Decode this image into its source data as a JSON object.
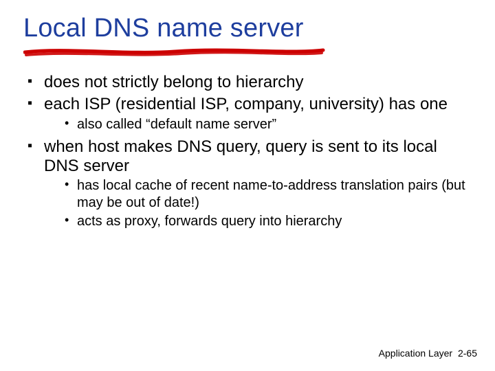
{
  "title": "Local DNS name server",
  "underline_color": "#cc0000",
  "bullets": [
    {
      "text": "does not strictly belong to hierarchy"
    },
    {
      "text": "each ISP (residential ISP, company, university) has one",
      "sub": [
        "also called “default name server”"
      ]
    },
    {
      "text": "when host makes DNS query, query is sent to its local DNS server",
      "sub": [
        "has local cache of recent name-to-address translation pairs (but may be out of date!)",
        "acts as proxy, forwards query into hierarchy"
      ]
    }
  ],
  "footer": {
    "label": "Application Layer",
    "page": "2-65"
  }
}
